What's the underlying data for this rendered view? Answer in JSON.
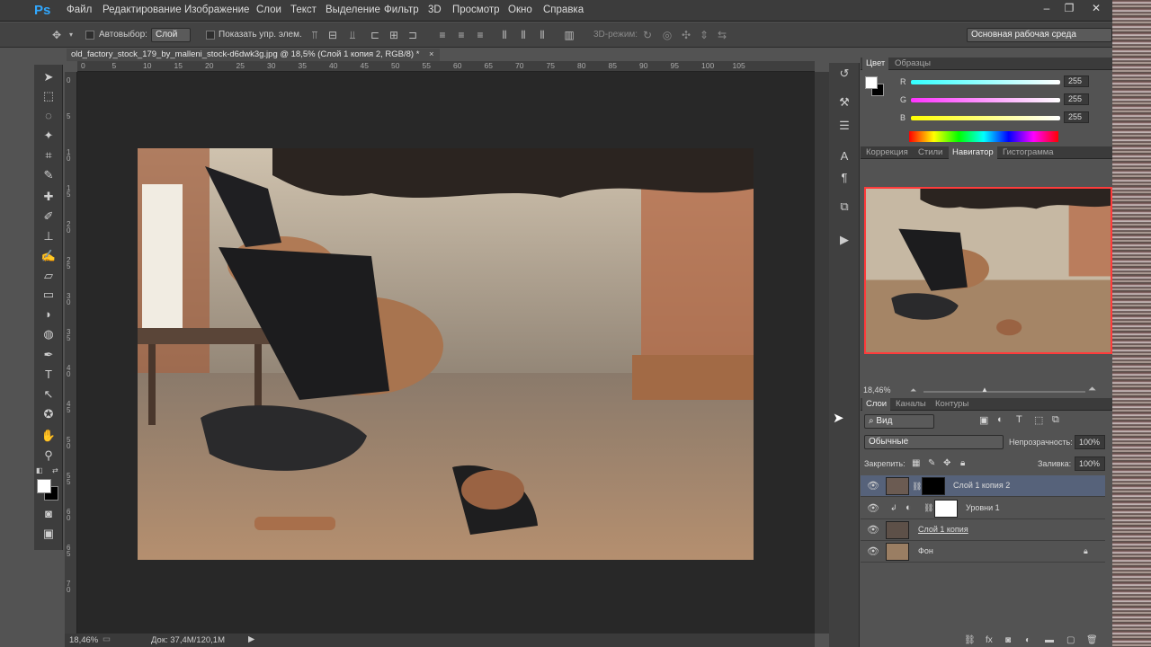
{
  "app": {
    "logo": "Ps",
    "menu": [
      "Файл",
      "Редактирование",
      "Изображение",
      "Слои",
      "Текст",
      "Выделение",
      "Фильтр",
      "3D",
      "Просмотр",
      "Окно",
      "Справка"
    ],
    "window_controls": [
      "–",
      "❐",
      "✕"
    ]
  },
  "options_bar": {
    "autoselect_label": "Автовыбор:",
    "autoselect_value": "Слой",
    "show_controls_label": "Показать упр. элем.",
    "mode3d_label": "3D-режим:",
    "workspace": "Основная рабочая среда"
  },
  "document": {
    "tab_title": "old_factory_stock_179_by_malleni_stock-d6dwk3g.jpg @ 18,5% (Слой 1 копия 2, RGB/8) *",
    "ruler_top": [
      "0",
      "5",
      "10",
      "15",
      "20",
      "25",
      "30",
      "35",
      "40",
      "45",
      "50",
      "55",
      "60",
      "65",
      "70",
      "75",
      "80",
      "85",
      "90",
      "95",
      "100",
      "105"
    ],
    "ruler_left": [
      "0",
      "5",
      "10",
      "15",
      "20",
      "25",
      "30",
      "35",
      "40",
      "45",
      "50",
      "55",
      "60",
      "65",
      "70"
    ],
    "zoom": "18,46%",
    "doc_size": "Док: 37,4M/120,1M"
  },
  "color_panel": {
    "tabs": [
      "Цвет",
      "Образцы"
    ],
    "channels": [
      {
        "label": "R",
        "value": "255"
      },
      {
        "label": "G",
        "value": "255"
      },
      {
        "label": "B",
        "value": "255"
      }
    ]
  },
  "navigator_panel": {
    "tabs": [
      "Коррекция",
      "Стили",
      "Навигатор",
      "Гистограмма"
    ],
    "zoom": "18,46%"
  },
  "layers_panel": {
    "tabs": [
      "Слои",
      "Каналы",
      "Контуры"
    ],
    "filter_kind": "Вид",
    "blend_mode": "Обычные",
    "opacity_label": "Непрозрачность:",
    "opacity_value": "100%",
    "lock_label": "Закрепить:",
    "fill_label": "Заливка:",
    "fill_value": "100%",
    "layers": [
      {
        "name": "Слой 1 копия 2",
        "selected": true
      },
      {
        "name": "Уровни 1",
        "selected": false
      },
      {
        "name": "Слой 1 копия",
        "selected": false
      },
      {
        "name": "Фон",
        "selected": false
      }
    ],
    "bottom_icons": [
      "link-icon",
      "fx-icon",
      "mask-icon",
      "adjustment-icon",
      "folder-icon",
      "new-layer-icon",
      "trash-icon"
    ]
  },
  "colors": {
    "accent_blue": "#31a8ff",
    "selected_layer": "#56627a",
    "navigator_frame": "#ff3b3b"
  }
}
